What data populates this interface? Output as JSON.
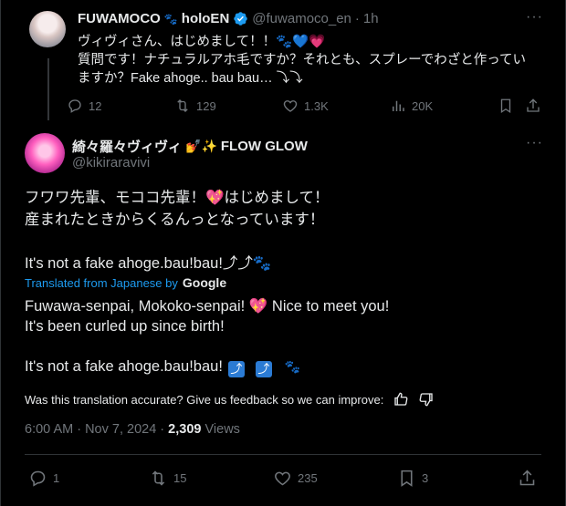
{
  "reply_tweet": {
    "name": "FUWAMOCO",
    "name_suffix": "holoEN",
    "handle": "@fuwamoco_en",
    "separator": "·",
    "time": "1h",
    "lines": [
      "ヴィヴィさん、はじめまして！！🐾💙💗",
      "質問です！ナチュラルアホ毛ですか？それとも、スプレーでわざと作ってい",
      "ますか？Fake ahoge.. bau bau… ⤵⤵"
    ],
    "stats": {
      "replies": "12",
      "reposts": "129",
      "likes": "1.3K",
      "views": "20K"
    }
  },
  "main_tweet": {
    "name": "綺々羅々ヴィヴィ",
    "name_emojis": "💅✨",
    "name_suffix": "FLOW GLOW",
    "handle": "@kikiraravivi",
    "original_lines": [
      "フワワ先輩、モココ先輩！💖はじめまして！",
      "産まれたときからくるんっとなっています！",
      "",
      "It's not a fake ahoge.bau!bau!⤴⤴🐾"
    ],
    "translated_label": "Translated from Japanese by",
    "translator": "Google",
    "translated_lines": [
      "Fuwawa-senpai, Mokoko-senpai! 💖 Nice to meet you!",
      "It's been curled up since birth!",
      "",
      "It's not a fake ahoge.bau!bau!"
    ],
    "translated_arrows": [
      "⤴",
      "⤴"
    ],
    "translated_paw": "🐾",
    "feedback_text": "Was this translation accurate? Give us feedback so we can improve:",
    "timestamp": "6:00 AM · Nov 7, 2024 · ",
    "views_count": "2,309",
    "views_label": " Views",
    "stats": {
      "replies": "1",
      "reposts": "15",
      "likes": "235",
      "bookmarks": "3"
    }
  },
  "icons": {
    "more": "more-icon",
    "reply": "reply-icon",
    "repost": "repost-icon",
    "like": "like-icon",
    "views": "views-icon",
    "bookmark": "bookmark-icon",
    "share": "share-icon",
    "thumbs_up": "thumbs-up-icon",
    "thumbs_down": "thumbs-down-icon",
    "verified": "verified-badge-icon"
  },
  "colors": {
    "background": "#000000",
    "text": "#e7e9ea",
    "muted": "#71767b",
    "link": "#1d9bf0",
    "verified": "#1d9bf0"
  }
}
